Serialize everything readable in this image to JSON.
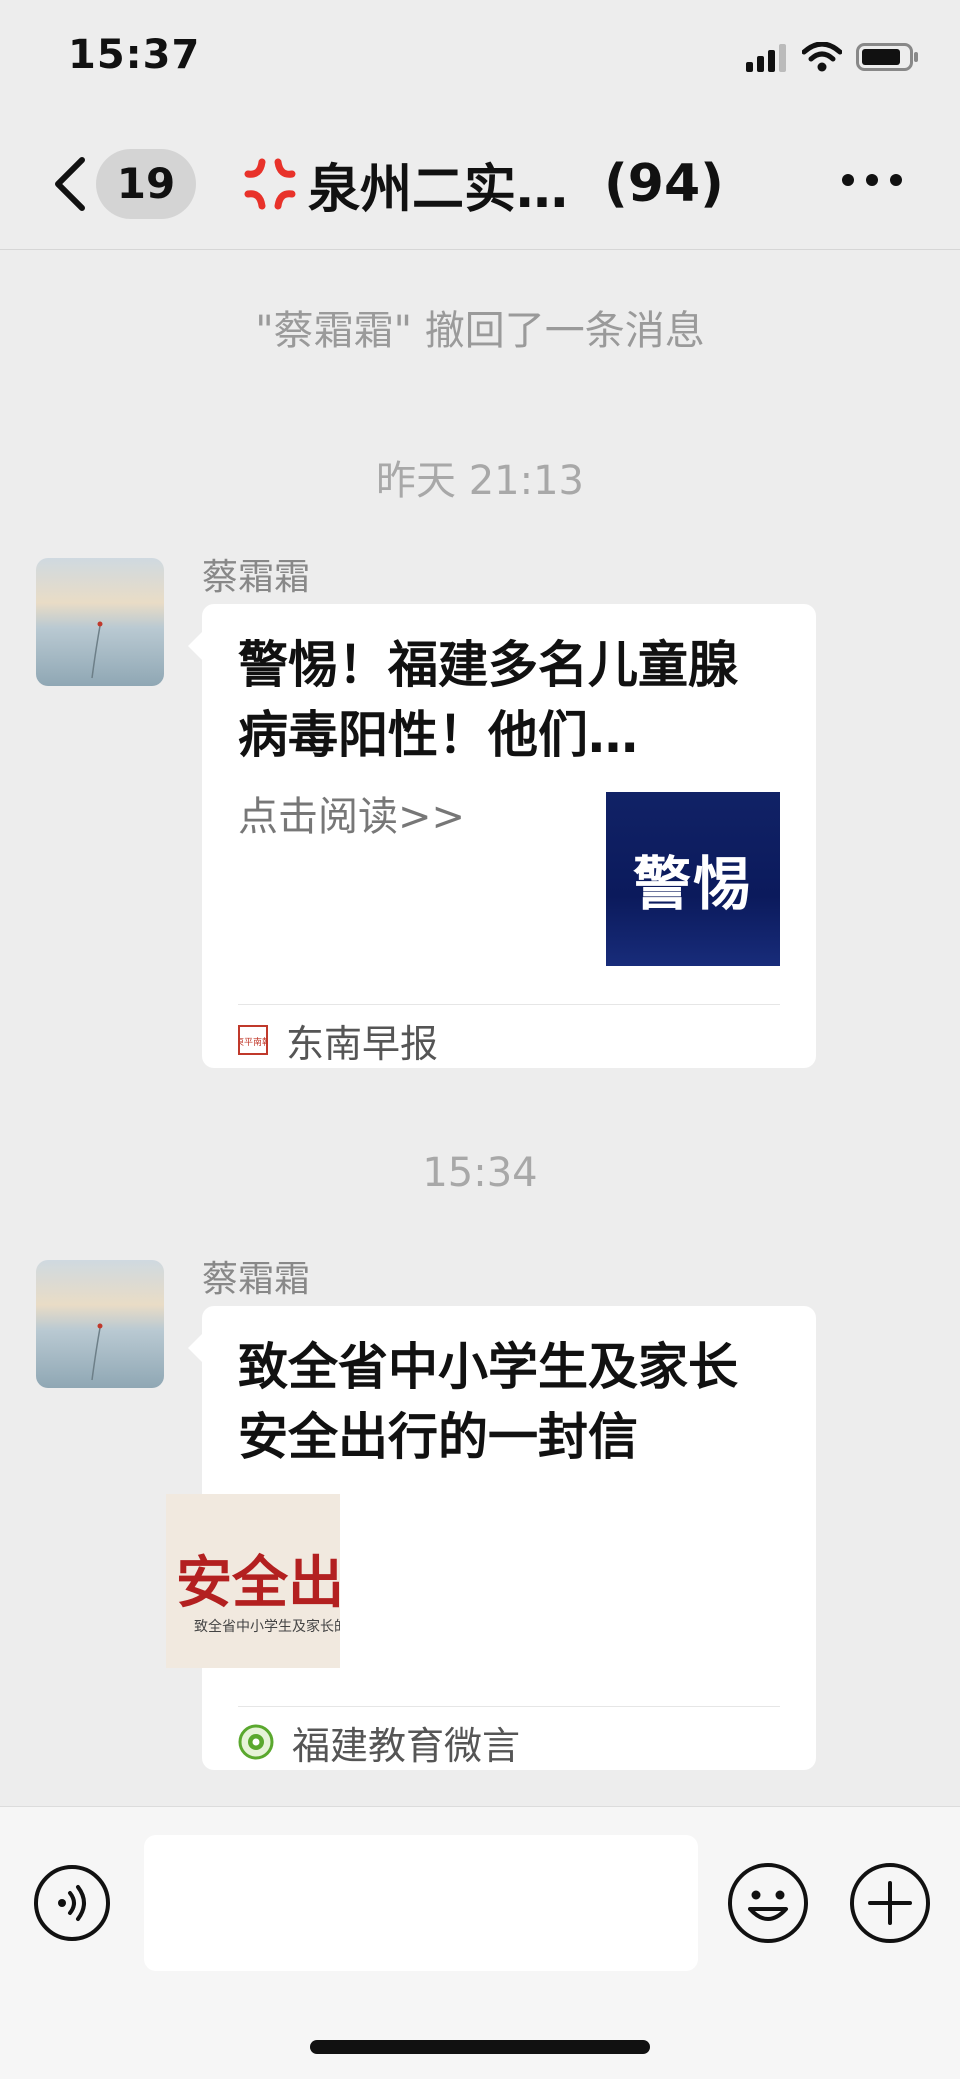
{
  "status": {
    "time": "15:37",
    "icons": [
      "signal-icon",
      "wifi-icon",
      "battery-icon"
    ]
  },
  "nav": {
    "back_icon": "chevron-left-icon",
    "unread_count": "19",
    "title_icon": "anger-emoji-icon",
    "title": "泉州二实…",
    "member_count": "(94)",
    "more_icon": "more-icon"
  },
  "messages": {
    "recall_note": "\"蔡霜霜\" 撤回了一条消息",
    "timestamp1": "昨天 21:13",
    "msg1": {
      "sender": "蔡霜霜",
      "title": "警惕！福建多名儿童腺病毒阳性！他们…",
      "desc": "点击阅读>>",
      "thumb_text": "警惕",
      "source": "东南早报",
      "source_icon_text": "東平南報"
    },
    "timestamp2": "15:34",
    "msg2": {
      "sender": "蔡霜霜",
      "title": "致全省中小学生及家长安全出行的一封信",
      "thumb_big": "安全出行",
      "thumb_small": "致全省中小学生及家长的",
      "source": "福建教育微言"
    }
  },
  "input_bar": {
    "voice_icon": "voice-icon",
    "input_value": "",
    "emoji_icon": "emoji-icon",
    "plus_icon": "plus-icon"
  },
  "colors": {
    "background": "#ededed",
    "bubble": "#ffffff",
    "alert_thumb": "#0b1a5c",
    "safety_red": "#b32020"
  }
}
